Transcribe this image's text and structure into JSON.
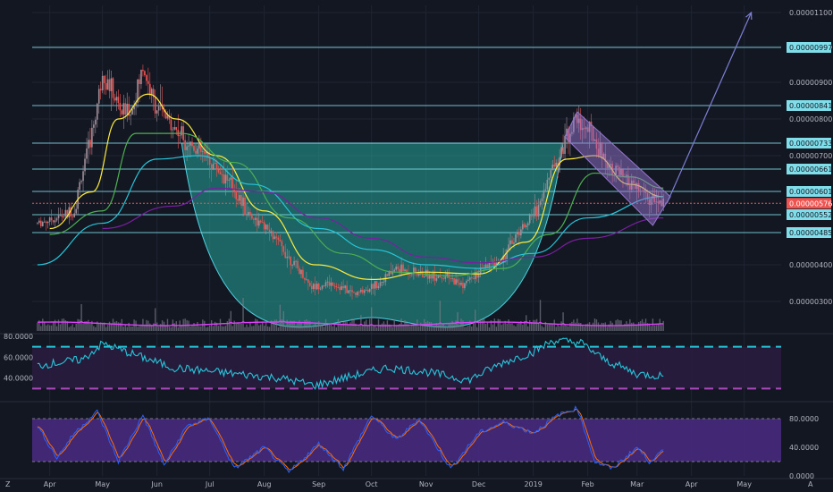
{
  "chart_data": {
    "type": "line",
    "timeframe": "daily candlestick",
    "x_ticks": [
      "Apr",
      "May",
      "Jun",
      "Jul",
      "Aug",
      "Sep",
      "Oct",
      "Nov",
      "Dec",
      "2019",
      "Feb",
      "Mar",
      "Apr",
      "May"
    ],
    "price_axis_ticks": [
      "0.00001100",
      "0.00001000",
      "0.00000900",
      "0.00000800",
      "0.00000700",
      "0.00000400",
      "0.00000300"
    ],
    "price_tags": [
      "0.00000997",
      "0.00000841",
      "0.00000733",
      "0.00000661",
      "0.00000601",
      "0.00000552",
      "0.00000485"
    ],
    "current_price": "0.00000576",
    "horizontal_levels": [
      9.97e-06,
      8.41e-06,
      7.33e-06,
      6.61e-06,
      6.01e-06,
      5.52e-06,
      4.85e-06
    ],
    "price_series": [
      {
        "date": "2018-03-25",
        "price": 5.2e-06
      },
      {
        "date": "2018-04-05",
        "price": 5.4e-06
      },
      {
        "date": "2018-04-15",
        "price": 5.6e-06
      },
      {
        "date": "2018-04-25",
        "price": 7.6e-06
      },
      {
        "date": "2018-05-01",
        "price": 9.3e-06
      },
      {
        "date": "2018-05-06",
        "price": 8.8e-06
      },
      {
        "date": "2018-05-12",
        "price": 8.2e-06
      },
      {
        "date": "2018-05-18",
        "price": 8.3e-06
      },
      {
        "date": "2018-05-24",
        "price": 9.4e-06
      },
      {
        "date": "2018-05-30",
        "price": 8.5e-06
      },
      {
        "date": "2018-06-08",
        "price": 7.9e-06
      },
      {
        "date": "2018-06-18",
        "price": 7.4e-06
      },
      {
        "date": "2018-06-28",
        "price": 7e-06
      },
      {
        "date": "2018-07-10",
        "price": 6.4e-06
      },
      {
        "date": "2018-07-22",
        "price": 5.6e-06
      },
      {
        "date": "2018-08-02",
        "price": 5e-06
      },
      {
        "date": "2018-08-15",
        "price": 4.2e-06
      },
      {
        "date": "2018-08-28",
        "price": 3.4e-06
      },
      {
        "date": "2018-09-08",
        "price": 3.5e-06
      },
      {
        "date": "2018-09-22",
        "price": 3.2e-06
      },
      {
        "date": "2018-10-05",
        "price": 3.5e-06
      },
      {
        "date": "2018-10-15",
        "price": 3.9e-06
      },
      {
        "date": "2018-10-28",
        "price": 3.75e-06
      },
      {
        "date": "2018-11-10",
        "price": 3.7e-06
      },
      {
        "date": "2018-11-22",
        "price": 3.45e-06
      },
      {
        "date": "2018-12-03",
        "price": 3.85e-06
      },
      {
        "date": "2018-12-15",
        "price": 4.2e-06
      },
      {
        "date": "2018-12-25",
        "price": 5e-06
      },
      {
        "date": "2019-01-05",
        "price": 5.8e-06
      },
      {
        "date": "2019-01-15",
        "price": 7e-06
      },
      {
        "date": "2019-01-25",
        "price": 8e-06
      },
      {
        "date": "2019-02-03",
        "price": 7.6e-06
      },
      {
        "date": "2019-02-12",
        "price": 6.8e-06
      },
      {
        "date": "2019-02-22",
        "price": 6.3e-06
      },
      {
        "date": "2019-03-03",
        "price": 6e-06
      },
      {
        "date": "2019-03-10",
        "price": 5.8e-06
      },
      {
        "date": "2019-03-16",
        "price": 5.76e-06
      }
    ],
    "moving_averages": [
      {
        "color": "#ffeb3b",
        "points": [
          {
            "date": "2018-04-01",
            "price": 5e-06
          },
          {
            "date": "2018-04-25",
            "price": 6e-06
          },
          {
            "date": "2018-05-10",
            "price": 8e-06
          },
          {
            "date": "2018-05-27",
            "price": 8.7e-06
          },
          {
            "date": "2018-06-12",
            "price": 8e-06
          },
          {
            "date": "2018-07-05",
            "price": 7e-06
          },
          {
            "date": "2018-08-01",
            "price": 5.6e-06
          },
          {
            "date": "2018-08-30",
            "price": 4e-06
          },
          {
            "date": "2018-10-01",
            "price": 3.6e-06
          },
          {
            "date": "2018-11-01",
            "price": 3.8e-06
          },
          {
            "date": "2018-12-01",
            "price": 3.75e-06
          },
          {
            "date": "2018-12-28",
            "price": 4.6e-06
          },
          {
            "date": "2019-01-20",
            "price": 6.9e-06
          },
          {
            "date": "2019-02-05",
            "price": 7e-06
          },
          {
            "date": "2019-02-25",
            "price": 6.2e-06
          },
          {
            "date": "2019-03-16",
            "price": 5.9e-06
          }
        ]
      },
      {
        "color": "#4caf50",
        "points": [
          {
            "date": "2018-04-01",
            "price": 4.8e-06
          },
          {
            "date": "2018-05-01",
            "price": 5.6e-06
          },
          {
            "date": "2018-05-20",
            "price": 7.6e-06
          },
          {
            "date": "2018-06-15",
            "price": 7.6e-06
          },
          {
            "date": "2018-07-15",
            "price": 6.8e-06
          },
          {
            "date": "2018-08-15",
            "price": 5.4e-06
          },
          {
            "date": "2018-09-15",
            "price": 4.3e-06
          },
          {
            "date": "2018-10-15",
            "price": 3.8e-06
          },
          {
            "date": "2018-11-15",
            "price": 3.7e-06
          },
          {
            "date": "2018-12-15",
            "price": 3.9e-06
          },
          {
            "date": "2019-01-10",
            "price": 4.8e-06
          },
          {
            "date": "2019-02-05",
            "price": 6.5e-06
          },
          {
            "date": "2019-02-25",
            "price": 6.4e-06
          },
          {
            "date": "2019-03-16",
            "price": 6.1e-06
          }
        ]
      },
      {
        "color": "#26c6da",
        "points": [
          {
            "date": "2018-03-25",
            "price": 4e-06
          },
          {
            "date": "2018-05-01",
            "price": 5.2e-06
          },
          {
            "date": "2018-06-01",
            "price": 6.9e-06
          },
          {
            "date": "2018-06-25",
            "price": 7e-06
          },
          {
            "date": "2018-07-25",
            "price": 6.2e-06
          },
          {
            "date": "2018-09-01",
            "price": 5e-06
          },
          {
            "date": "2018-10-01",
            "price": 4.4e-06
          },
          {
            "date": "2018-11-01",
            "price": 4e-06
          },
          {
            "date": "2018-12-01",
            "price": 3.9e-06
          },
          {
            "date": "2019-01-01",
            "price": 4.3e-06
          },
          {
            "date": "2019-02-01",
            "price": 5.4e-06
          },
          {
            "date": "2019-03-16",
            "price": 5.9e-06
          }
        ]
      },
      {
        "color": "#7b1fa2",
        "points": [
          {
            "date": "2018-05-01",
            "price": 5e-06
          },
          {
            "date": "2018-06-10",
            "price": 5.7e-06
          },
          {
            "date": "2018-07-05",
            "price": 6.1e-06
          },
          {
            "date": "2018-08-01",
            "price": 6e-06
          },
          {
            "date": "2018-09-01",
            "price": 5.4e-06
          },
          {
            "date": "2018-10-01",
            "price": 4.7e-06
          },
          {
            "date": "2018-11-01",
            "price": 4.2e-06
          },
          {
            "date": "2018-12-01",
            "price": 4.05e-06
          },
          {
            "date": "2019-01-01",
            "price": 4.2e-06
          },
          {
            "date": "2019-02-01",
            "price": 4.7e-06
          },
          {
            "date": "2019-03-16",
            "price": 5.4e-06
          }
        ]
      }
    ],
    "cup": {
      "rim_price": 7.33e-06,
      "bottom_price": 2.55e-06,
      "start_date": "2018-06-15",
      "end_date": "2019-01-18",
      "color": "#26a69a"
    },
    "flag_channel": {
      "color": "#9575cd",
      "points": [
        {
          "date": "2019-01-26",
          "price": 8.22e-06
        },
        {
          "date": "2019-03-20",
          "price": 5.9e-06
        },
        {
          "date": "2019-03-10",
          "price": 5.12e-06
        },
        {
          "date": "2019-01-19",
          "price": 7.5e-06
        }
      ]
    },
    "projection_arrow": {
      "color": "#7e7fd4",
      "from": {
        "date": "2019-03-18",
        "price": 5.76e-06
      },
      "to": {
        "date": "2019-05-05",
        "price": 1.1e-05
      }
    },
    "volume_panel": {
      "ma_color": "#e040fb"
    },
    "rsi_panel": {
      "axis_ticks": [
        "80.0000",
        "60.0000",
        "40.0000"
      ],
      "y_range": [
        20,
        80
      ],
      "upper_band": 70,
      "lower_band": 30,
      "line_color": "#26c6da",
      "points": [
        {
          "date": "2018-03-25",
          "value": 52
        },
        {
          "date": "2018-04-20",
          "value": 58
        },
        {
          "date": "2018-05-01",
          "value": 73
        },
        {
          "date": "2018-05-20",
          "value": 62
        },
        {
          "date": "2018-06-10",
          "value": 50
        },
        {
          "date": "2018-07-10",
          "value": 45
        },
        {
          "date": "2018-08-10",
          "value": 40
        },
        {
          "date": "2018-08-30",
          "value": 33
        },
        {
          "date": "2018-09-20",
          "value": 42
        },
        {
          "date": "2018-10-10",
          "value": 50
        },
        {
          "date": "2018-11-01",
          "value": 46
        },
        {
          "date": "2018-11-25",
          "value": 38
        },
        {
          "date": "2018-12-15",
          "value": 55
        },
        {
          "date": "2019-01-01",
          "value": 65
        },
        {
          "date": "2019-01-12",
          "value": 76
        },
        {
          "date": "2019-01-28",
          "value": 74
        },
        {
          "date": "2019-02-10",
          "value": 58
        },
        {
          "date": "2019-03-01",
          "value": 44
        },
        {
          "date": "2019-03-16",
          "value": 42
        }
      ]
    },
    "stoch_panel": {
      "axis_ticks": [
        "80.0000",
        "40.0000",
        "0.0000"
      ],
      "y_range": [
        0,
        100
      ],
      "upper_band": 80,
      "lower_band": 20,
      "k_color": "#2962ff",
      "d_color": "#ff6d00",
      "points": [
        {
          "date": "2018-03-25",
          "value": 70
        },
        {
          "date": "2018-04-05",
          "value": 25
        },
        {
          "date": "2018-04-15",
          "value": 60
        },
        {
          "date": "2018-04-28",
          "value": 90
        },
        {
          "date": "2018-05-10",
          "value": 20
        },
        {
          "date": "2018-05-24",
          "value": 85
        },
        {
          "date": "2018-06-05",
          "value": 15
        },
        {
          "date": "2018-06-18",
          "value": 70
        },
        {
          "date": "2018-07-01",
          "value": 80
        },
        {
          "date": "2018-07-15",
          "value": 10
        },
        {
          "date": "2018-08-01",
          "value": 40
        },
        {
          "date": "2018-08-15",
          "value": 5
        },
        {
          "date": "2018-09-01",
          "value": 45
        },
        {
          "date": "2018-09-15",
          "value": 10
        },
        {
          "date": "2018-10-01",
          "value": 85
        },
        {
          "date": "2018-10-15",
          "value": 50
        },
        {
          "date": "2018-10-28",
          "value": 80
        },
        {
          "date": "2018-11-15",
          "value": 10
        },
        {
          "date": "2018-12-01",
          "value": 60
        },
        {
          "date": "2018-12-15",
          "value": 75
        },
        {
          "date": "2019-01-01",
          "value": 60
        },
        {
          "date": "2019-01-15",
          "value": 85
        },
        {
          "date": "2019-01-26",
          "value": 95
        },
        {
          "date": "2019-02-05",
          "value": 20
        },
        {
          "date": "2019-02-15",
          "value": 10
        },
        {
          "date": "2019-03-01",
          "value": 40
        },
        {
          "date": "2019-03-08",
          "value": 20
        },
        {
          "date": "2019-03-16",
          "value": 35
        }
      ]
    }
  },
  "colors": {
    "background": "#131722",
    "grid": "#1f2433",
    "level_line": "#80deea",
    "tag_fill": "#80deea",
    "current_tag_fill": "#ef5350",
    "current_line": "#ef5350",
    "up_candle": "#9e8f99",
    "down_candle": "#ef5350",
    "volume_bar": "#787b86",
    "rsi_band_fill": "#2a1c3f",
    "rsi_upper_band": "#26c6da",
    "rsi_lower_band": "#ab47bc",
    "stoch_band_fill": "#4a2a82"
  },
  "footer": {
    "left_icon_label": "Z",
    "right_icon_label": "A"
  }
}
